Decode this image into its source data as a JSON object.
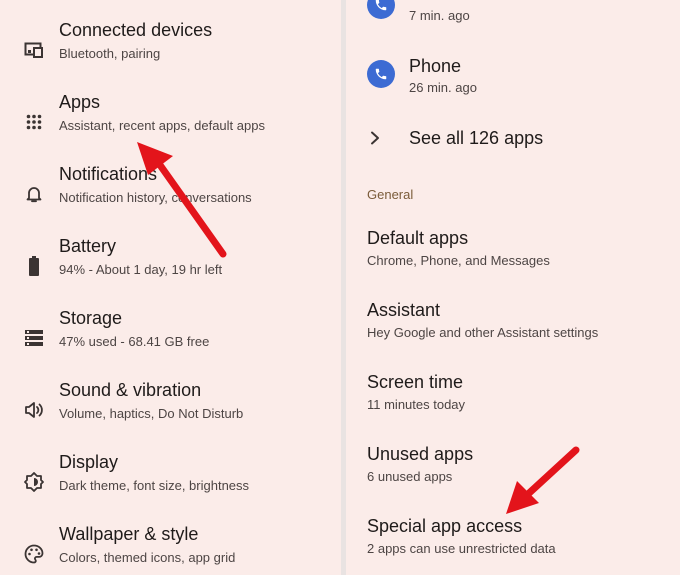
{
  "left_panel": {
    "items": [
      {
        "title": "Connected devices",
        "subtitle": "Bluetooth, pairing",
        "icon": "devices-icon"
      },
      {
        "title": "Apps",
        "subtitle": "Assistant, recent apps, default apps",
        "icon": "apps-grid-icon"
      },
      {
        "title": "Notifications",
        "subtitle": "Notification history, conversations",
        "icon": "bell-icon"
      },
      {
        "title": "Battery",
        "subtitle": "94% - About 1 day, 19 hr left",
        "icon": "battery-icon"
      },
      {
        "title": "Storage",
        "subtitle": "47% used - 68.41 GB free",
        "icon": "storage-icon"
      },
      {
        "title": "Sound & vibration",
        "subtitle": "Volume, haptics, Do Not Disturb",
        "icon": "speaker-icon"
      },
      {
        "title": "Display",
        "subtitle": "Dark theme, font size, brightness",
        "icon": "brightness-icon"
      },
      {
        "title": "Wallpaper & style",
        "subtitle": "Colors, themed icons, app grid",
        "icon": "palette-icon"
      }
    ]
  },
  "right_panel": {
    "recent_apps": [
      {
        "title": "",
        "subtitle": "7 min. ago",
        "icon": "phone-app-icon"
      },
      {
        "title": "Phone",
        "subtitle": "26 min. ago",
        "icon": "phone-app-icon"
      }
    ],
    "see_all": {
      "label": "See all 126 apps",
      "icon": "chevron-right-icon"
    },
    "section_header": "General",
    "items": [
      {
        "title": "Default apps",
        "subtitle": "Chrome, Phone, and Messages"
      },
      {
        "title": "Assistant",
        "subtitle": "Hey Google and other Assistant settings"
      },
      {
        "title": "Screen time",
        "subtitle": "11 minutes today"
      },
      {
        "title": "Unused apps",
        "subtitle": "6 unused apps"
      },
      {
        "title": "Special app access",
        "subtitle": "2 apps can use unrestricted data"
      }
    ]
  },
  "colors": {
    "panel_bg": "#fbece9",
    "divider": "#e9e3e2",
    "arrow": "#e3141b",
    "app_icon": "#3c6bd3",
    "section_header": "#7b5c3a"
  }
}
